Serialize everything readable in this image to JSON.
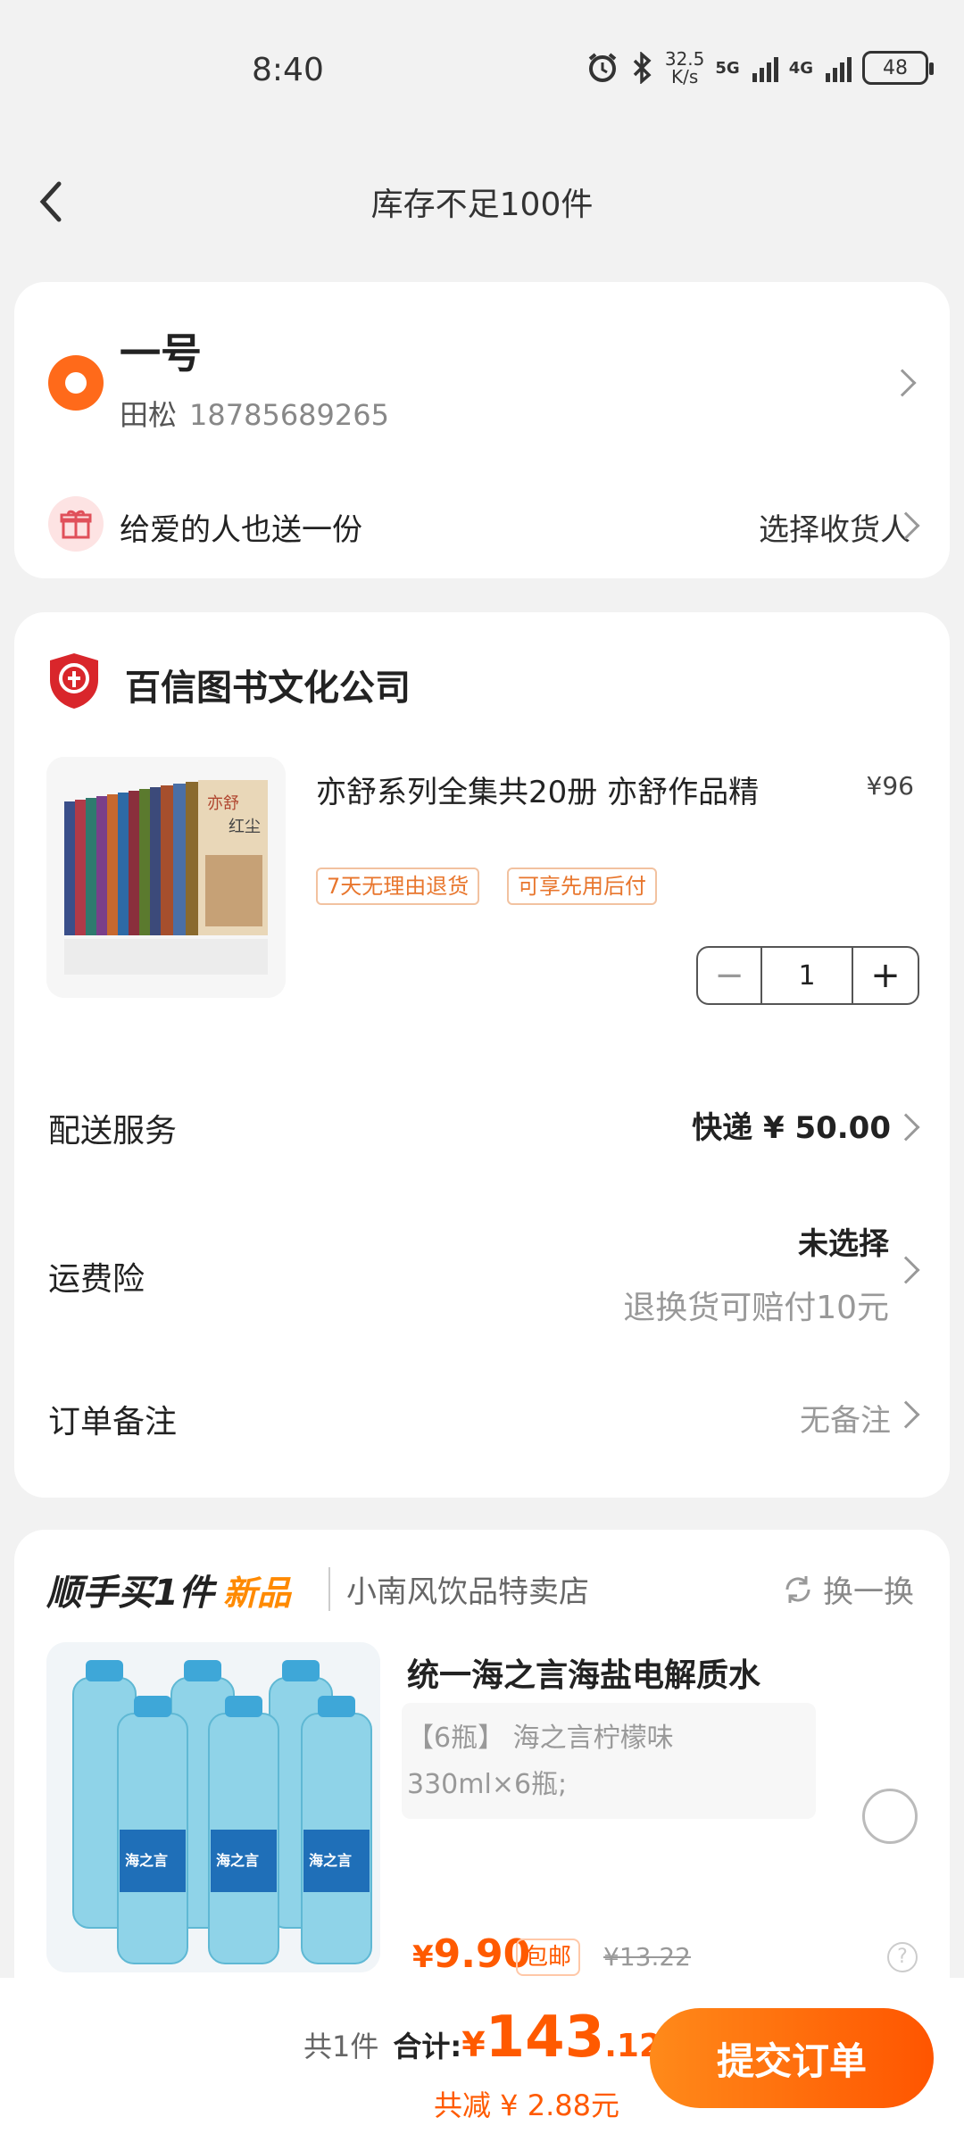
{
  "status_bar": {
    "time": "8:40",
    "net_speed": "32.5",
    "net_unit": "K/s",
    "sig1": "5G",
    "sig2": "4G",
    "battery": "48"
  },
  "nav": {
    "title": "库存不足100件"
  },
  "address": {
    "name": "一号",
    "recipient": "田松",
    "phone": "18785689265",
    "gift_text": "给爱的人也送一份",
    "pick_receiver": "选择收货人"
  },
  "shop": {
    "name": "百信图书文化公司"
  },
  "product": {
    "title": "亦舒系列全集共20册 亦舒作品精",
    "price": "¥96",
    "tags": [
      "7天无理由退货",
      "可享先用后付"
    ],
    "quantity": "1",
    "qty_minus": "−",
    "qty_plus": "+",
    "book_cover_text": "亦舒",
    "book_cover_sub": "红尘"
  },
  "rows": {
    "delivery_label": "配送服务",
    "delivery_value": "快递 ¥ 50.00",
    "insurance_label": "运费险",
    "insurance_value": "未选择",
    "insurance_sub": "退换货可赔付10元",
    "note_label": "订单备注",
    "note_value": "无备注"
  },
  "upsell": {
    "title": "顺手买1件",
    "new_label": "新品",
    "shop": "小南风饮品特卖店",
    "swap": "换一换",
    "product_title": "统一海之言海盐电解质水",
    "spec_line1": "【6瓶】 海之言柠檬味",
    "spec_line2": "330ml×6瓶;",
    "price_yen": "¥",
    "price": "9.90",
    "free_ship": "包邮",
    "orig_price": "¥13.22",
    "bottle_label": "海之言"
  },
  "bottom": {
    "count": "共1件",
    "total_label": "合计:",
    "total_yen": "¥",
    "total_int": "143",
    "total_dec": ".12",
    "discount": "共减 ¥ 2.88元",
    "submit": "提交订单"
  },
  "colors": {
    "accent": "#ff5a00",
    "accent_light": "#ff8a1a",
    "tag": "#e8762d",
    "new": "#ff8a00"
  }
}
